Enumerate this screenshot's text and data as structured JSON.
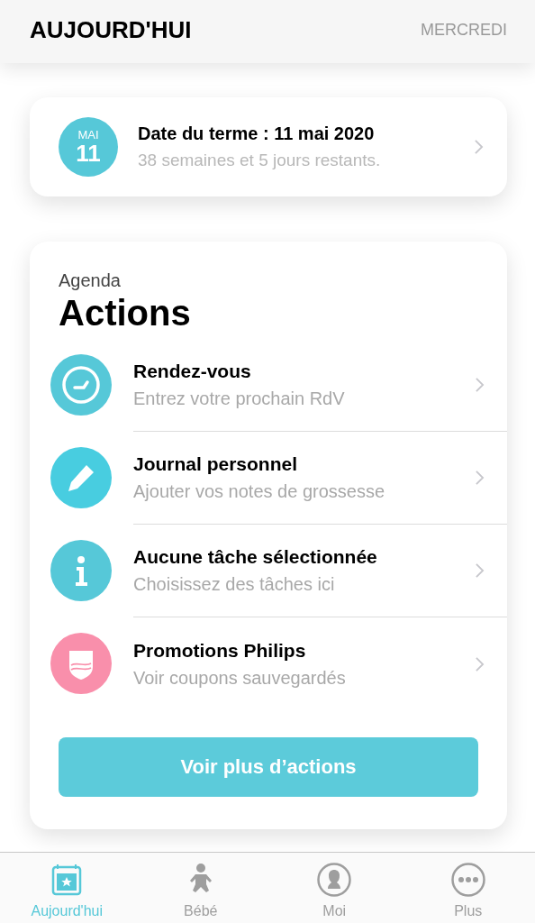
{
  "header": {
    "title": "AUJOURD'HUI",
    "day": "MERCREDI"
  },
  "due_card": {
    "month": "MAI",
    "day": "11",
    "title": "Date du terme : 11 mai 2020",
    "subtitle": "38 semaines et 5 jours restants."
  },
  "agenda": {
    "label": "Agenda",
    "title": "Actions",
    "items": [
      {
        "kind": "clock",
        "color": "#56c8d8",
        "title": "Rendez-vous",
        "subtitle": "Entrez votre prochain RdV"
      },
      {
        "kind": "pencil",
        "color": "#48cde0",
        "title": "Journal personnel",
        "subtitle": "Ajouter vos notes de grossesse"
      },
      {
        "kind": "info",
        "color": "#56c8d8",
        "title": "Aucune tâche sélectionnée",
        "subtitle": "Choisissez des tâches ici"
      },
      {
        "kind": "shield",
        "color": "#f98fab",
        "title": "Promotions Philips",
        "subtitle": "Voir coupons sauvegardés"
      }
    ],
    "button": "Voir plus d’actions"
  },
  "tab_bar": [
    {
      "kind": "calendar",
      "label": "Aujourd'hui",
      "selected": true
    },
    {
      "kind": "baby",
      "label": "Bébé",
      "selected": false
    },
    {
      "kind": "person",
      "label": "Moi",
      "selected": false
    },
    {
      "kind": "more",
      "label": "Plus",
      "selected": false
    }
  ]
}
